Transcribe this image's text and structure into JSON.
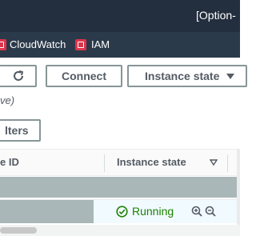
{
  "topbar": {
    "text": "[Option-"
  },
  "bookmarks": [
    {
      "label": "CloudWatch",
      "icon": "cloudwatch-icon"
    },
    {
      "label": "IAM",
      "icon": "iam-icon"
    }
  ],
  "toolbar": {
    "refresh_icon": "refresh-icon",
    "connect_label": "Connect",
    "instance_state_label": "Instance state"
  },
  "note": "ve)",
  "filters_label": "lters",
  "table": {
    "columns": [
      "e ID",
      "Instance state"
    ],
    "rows": [
      {
        "state": "Running"
      }
    ]
  },
  "colors": {
    "header_dark": "#232f3e",
    "running_green": "#1d8102",
    "selected_row": "#f1faff"
  }
}
